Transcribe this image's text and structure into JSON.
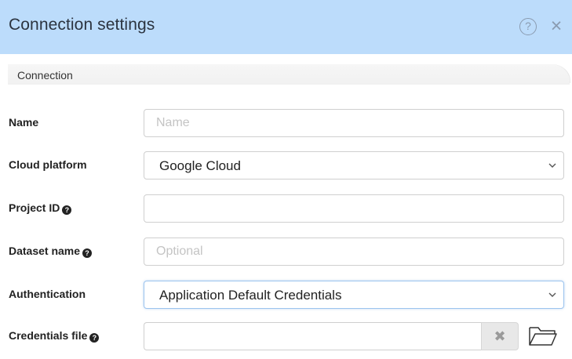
{
  "dialog": {
    "title": "Connection settings",
    "help_symbol": "?",
    "close_symbol": "×"
  },
  "tabs": [
    {
      "label": "Connection"
    }
  ],
  "form": {
    "name": {
      "label": "Name",
      "value": "",
      "placeholder": "Name"
    },
    "cloud_platform": {
      "label": "Cloud platform",
      "selected": "Google Cloud"
    },
    "project_id": {
      "label": "Project ID",
      "value": "",
      "placeholder": ""
    },
    "dataset_name": {
      "label": "Dataset name",
      "value": "",
      "placeholder": "Optional"
    },
    "authentication": {
      "label": "Authentication",
      "selected": "Application Default Credentials"
    },
    "credentials_file": {
      "label": "Credentials file",
      "value": "",
      "clear_symbol": "✖"
    },
    "help_badge": "?"
  },
  "colors": {
    "header_bg": "#bcdcfb",
    "icon_gray": "#8a9bb0",
    "border": "#cfcfcf",
    "placeholder": "#c4c4c4"
  },
  "icons": {
    "help": "question-circle-icon",
    "close": "close-icon",
    "select": "chevron-down-icon",
    "browse": "folder-icon",
    "field_help": "question-circle-icon"
  }
}
